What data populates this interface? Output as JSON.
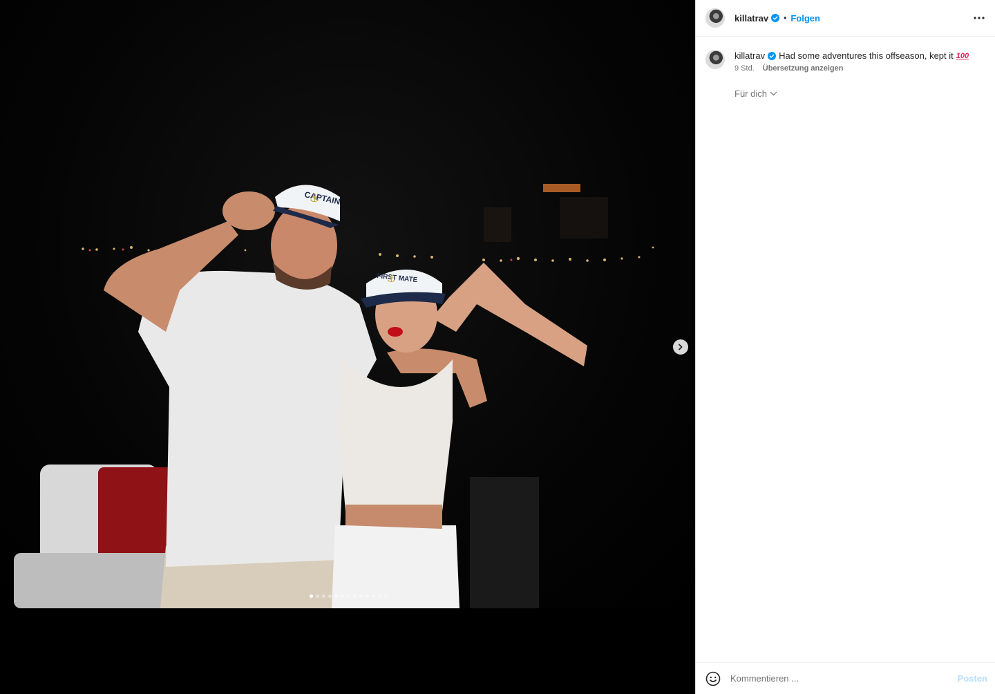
{
  "header": {
    "username": "killatrav",
    "separator": "•",
    "follow_label": "Folgen"
  },
  "caption": {
    "username": "killatrav",
    "text": "Had some adventures this offseason, kept it",
    "emoji": "100",
    "time": "9 Std.",
    "translate_label": "Übersetzung anzeigen"
  },
  "feed_filter": {
    "label": "Für dich"
  },
  "comment": {
    "placeholder": "Kommentieren ...",
    "post_label": "Posten"
  },
  "carousel": {
    "total_slides": 13,
    "current_slide": 1
  },
  "photo": {
    "hat_left_text": "CAPTAIN",
    "hat_right_text": "FIRST MATE"
  },
  "icons": {
    "verified": "verified-badge-icon",
    "more": "more-options-icon",
    "next": "chevron-right-icon",
    "emoji": "emoji-icon",
    "chevron_down": "chevron-down-icon"
  },
  "colors": {
    "accent": "#0095f6",
    "post_disabled": "#b2dffc",
    "secondary_text": "#737373"
  }
}
